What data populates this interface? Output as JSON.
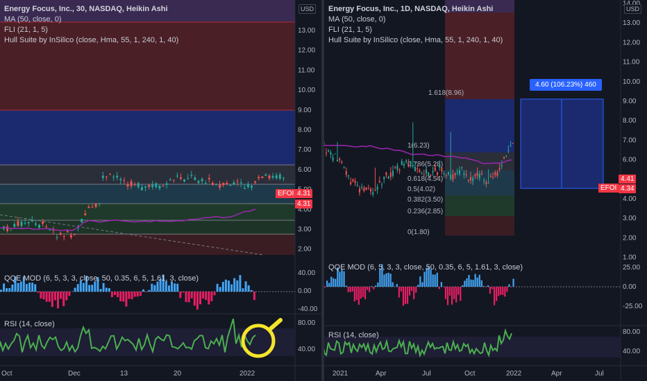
{
  "left": {
    "title": "Energy Focus, Inc., 30, NASDAQ, Heikin Ashi",
    "indicators": [
      "MA (50, close, 0)",
      "FLI (21, 1, 5)",
      "Hull Suite by InSilico (close, Hma, 55, 1, 240, 1, 40)"
    ],
    "currency": "USD",
    "price_ticks": [
      "13.00",
      "12.00",
      "11.00",
      "10.00",
      "9.00",
      "8.00",
      "7.00",
      "6.00",
      "5.00",
      "4.00",
      "3.00",
      "2.00"
    ],
    "price_tags": [
      {
        "text": "4.31",
        "color": "#f23645"
      },
      {
        "text": "4.31",
        "color": "#f23645"
      }
    ],
    "symbol_tag": "EFOI",
    "qqe_label": "QQE MOD (6, 5, 3, 3, close, 50, 0.35, 6, 5, 1.61, 3, close)",
    "qqe_ticks": [
      "40.00",
      "0.00",
      "-40.00"
    ],
    "rsi_label": "RSI (14, close)",
    "rsi_ticks": [
      "80.00",
      "40.00"
    ],
    "time_ticks": [
      "Oct",
      "Dec",
      "13",
      "20",
      "2022"
    ]
  },
  "right": {
    "title": "Energy Focus, Inc., 1D, NASDAQ, Heikin Ashi",
    "indicators": [
      "MA (50, close, 0)",
      "FLI (21, 1, 5)",
      "Hull Suite by InSilico (close, Hma, 55, 1, 240, 1, 40)"
    ],
    "currency": "USD",
    "price_ticks": [
      "14.00",
      "13.00",
      "12.00",
      "11.00",
      "10.00",
      "9.00",
      "8.00",
      "7.00",
      "6.00",
      "5.00",
      "4.00",
      "3.00",
      "2.00",
      "1.00"
    ],
    "price_tags": [
      {
        "text": "4.41",
        "color": "#f23645"
      },
      {
        "text": "4.34",
        "color": "#f23645"
      }
    ],
    "symbol_tag": "EFOI",
    "fib_levels": [
      "1.618(8.96)",
      "1(6.23)",
      "0.786(5.28)",
      "0.618(4.54)",
      "0.5(4.02)",
      "0.382(3.50)",
      "0.236(2.85)",
      "0(1.80)"
    ],
    "measure_label": "4.60 (106.23%) 460",
    "qqe_label": "QQE MOD (6, 5, 3, 3, close, 50, 0.35, 6, 5, 1.61, 3, close)",
    "qqe_ticks": [
      "25.00",
      "0.00",
      "-25.00"
    ],
    "rsi_label": "RSI (14, close)",
    "rsi_ticks": [
      "80.00",
      "40.00"
    ],
    "time_ticks": [
      "2021",
      "Apr",
      "Jul",
      "Oct",
      "2022",
      "Apr",
      "Jul"
    ]
  }
}
